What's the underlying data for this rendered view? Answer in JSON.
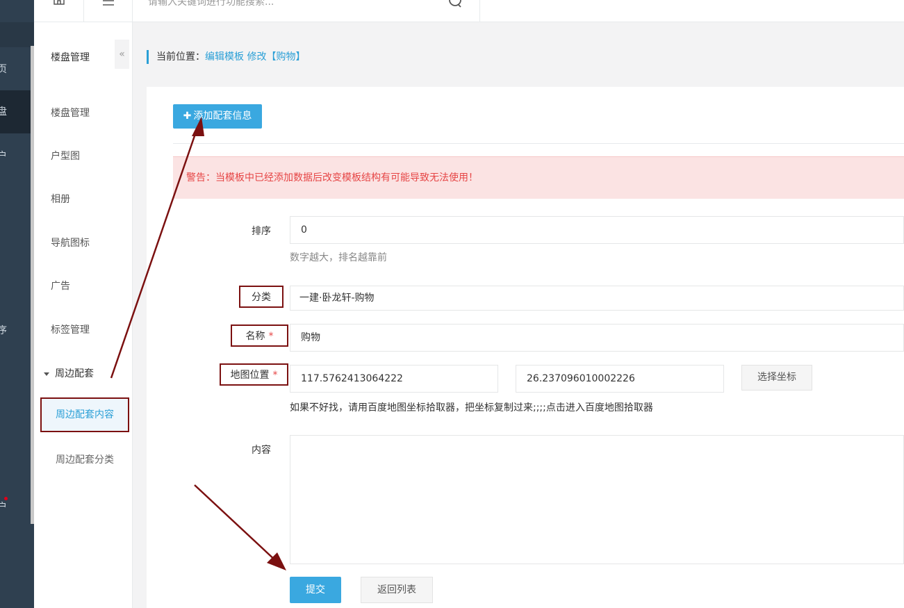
{
  "topbar": {
    "search_placeholder": "请输入关键词进行功能搜索..."
  },
  "left_nav": {
    "glyphs": [
      "页",
      "盘",
      "户",
      "序",
      "户"
    ]
  },
  "subnav": {
    "title": "楼盘管理",
    "items": [
      {
        "label": "楼盘管理"
      },
      {
        "label": "户型图"
      },
      {
        "label": "相册"
      },
      {
        "label": "导航图标"
      },
      {
        "label": "广告"
      },
      {
        "label": "标签管理"
      }
    ],
    "group": {
      "label": "周边配套",
      "active_child": "周边配套内容",
      "child": "周边配套分类"
    }
  },
  "breadcrumb": {
    "label": "当前位置：",
    "link1": "编辑模板",
    "link2": "修改【购物】"
  },
  "form": {
    "add_button": "添加配套信息",
    "warning": "警告：当模板中已经添加数据后改变模板结构有可能导致无法使用！",
    "sort_label": "排序",
    "sort_value": "0",
    "sort_help": "数字越大，排名越靠前",
    "category_label": "分类",
    "category_value": "一建·卧龙轩-购物",
    "name_label": "名称",
    "name_value": "购物",
    "map_label": "地图位置",
    "lng_value": "117.5762413064222",
    "lat_value": "26.237096010002226",
    "pick_button": "选择坐标",
    "map_help": "如果不好找，请用百度地图坐标拾取器，把坐标复制过来;;;;点击进入百度地图拾取器",
    "content_label": "内容",
    "required_mark": "*",
    "submit_button": "提交",
    "back_button": "返回列表"
  },
  "colors": {
    "accent": "#3aa8e0",
    "annotation": "#7b1010",
    "warning_bg": "#fbe3e3",
    "warning_text": "#e64545",
    "sidebar_dark": "#2f4050"
  }
}
